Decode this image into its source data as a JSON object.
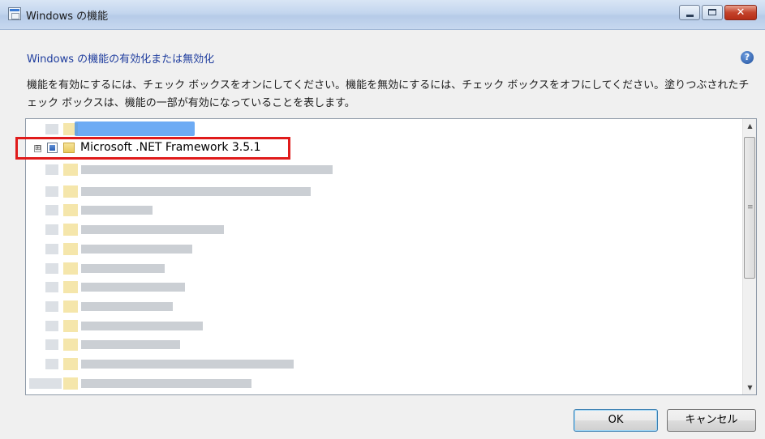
{
  "window": {
    "title": "Windows の機能",
    "controls": {
      "minimize_icon": "minimize-icon",
      "maximize_icon": "maximize-icon",
      "close_label": "✕"
    }
  },
  "header": {
    "heading": "Windows の機能の有効化または無効化",
    "help_icon": "?"
  },
  "description": "機能を有効にするには、チェック ボックスをオンにしてください。機能を無効にするには、チェック ボックスをオフにしてください。塗りつぶされたチェック ボックスは、機能の一部が有効になっていることを表します。",
  "features": {
    "highlighted_item": {
      "expander": "⊞",
      "label": "Microsoft .NET Framework 3.5.1",
      "check_state": "partial"
    }
  },
  "colors": {
    "heading": "#1f3d9e",
    "highlight_box": "#e01b1b",
    "partial_check": "#2a5fb2"
  },
  "buttons": {
    "ok": "OK",
    "cancel": "キャンセル"
  }
}
